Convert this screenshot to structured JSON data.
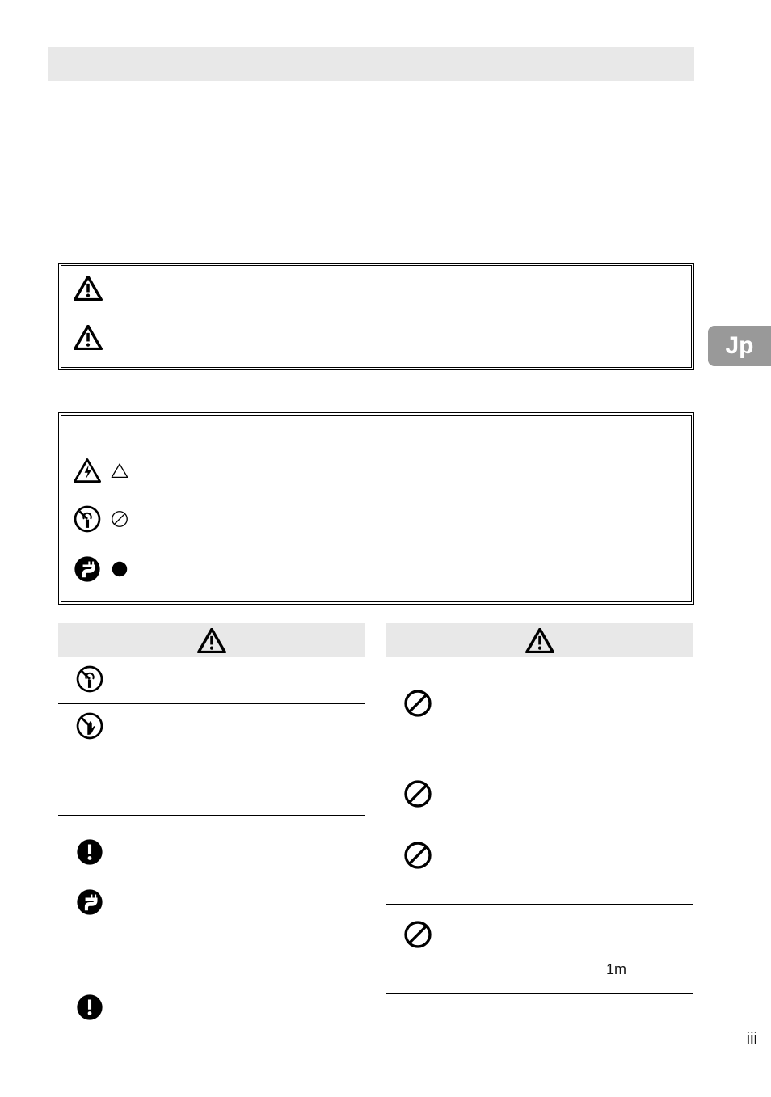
{
  "title_bar": "",
  "side_tab_label": "Jp",
  "page_number": "iii",
  "right_column": {
    "entry4_note": "1m"
  },
  "icons": {
    "warning_triangle": "warning-triangle-icon",
    "electric_triangle": "electric-shock-triangle-icon",
    "outline_triangle": "outline-triangle-icon",
    "no_disassemble": "no-disassemble-icon",
    "prohibition_outline": "prohibition-outline-icon",
    "unplug": "unplug-icon",
    "solid_circle": "solid-circle-icon",
    "prohibition": "prohibition-icon",
    "no_touch": "no-touch-icon",
    "mandatory": "mandatory-exclamation-icon"
  }
}
